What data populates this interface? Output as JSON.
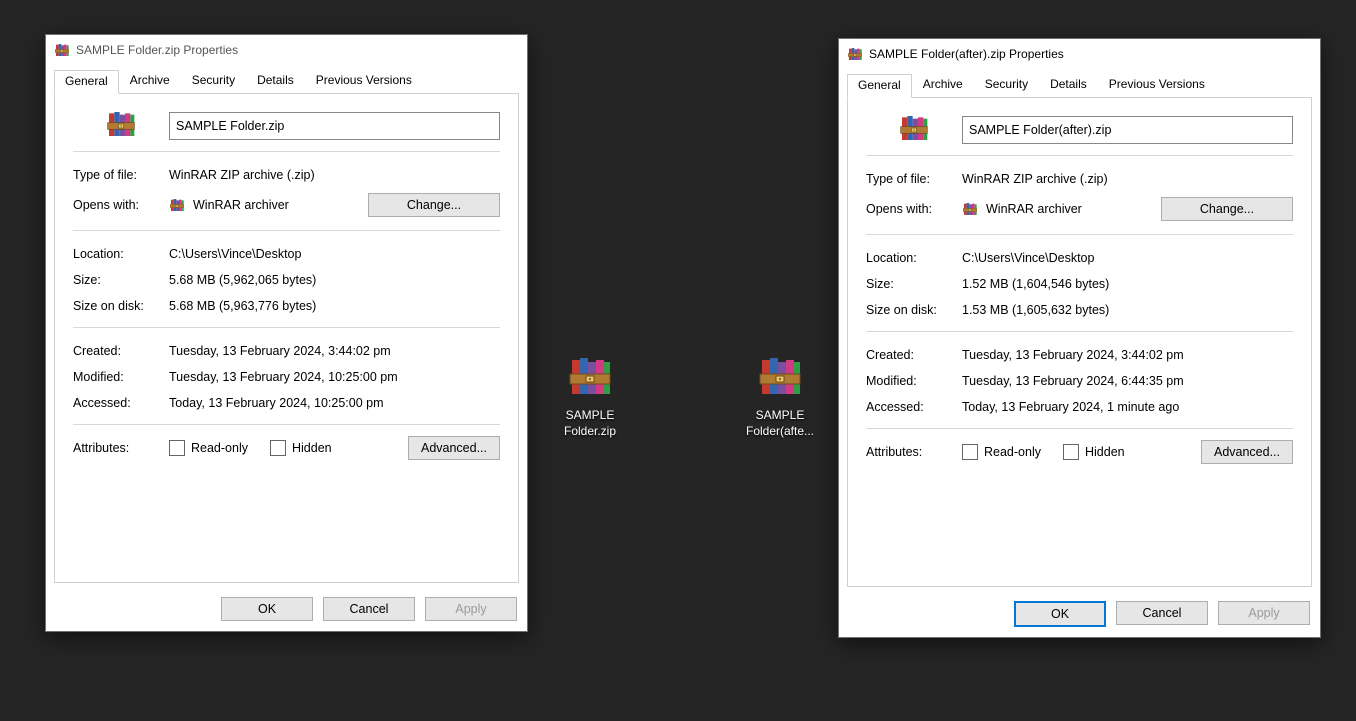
{
  "desktop": {
    "icons": [
      {
        "label": "SAMPLE Folder.zip"
      },
      {
        "label": "SAMPLE Folder(afte..."
      }
    ]
  },
  "tabs": [
    "General",
    "Archive",
    "Security",
    "Details",
    "Previous Versions"
  ],
  "labels": {
    "typeOfFile": "Type of file:",
    "opensWith": "Opens with:",
    "change": "Change...",
    "location": "Location:",
    "size": "Size:",
    "sizeOnDisk": "Size on disk:",
    "created": "Created:",
    "modified": "Modified:",
    "accessed": "Accessed:",
    "attributes": "Attributes:",
    "readOnly": "Read-only",
    "hidden": "Hidden",
    "advanced": "Advanced...",
    "ok": "OK",
    "cancel": "Cancel",
    "apply": "Apply"
  },
  "common": {
    "fileType": "WinRAR ZIP archive (.zip)",
    "opensWithApp": "WinRAR archiver",
    "locationPath": "C:\\Users\\Vince\\Desktop"
  },
  "dlg1": {
    "title": "SAMPLE Folder.zip Properties",
    "filename": "SAMPLE Folder.zip",
    "size": "5.68 MB (5,962,065 bytes)",
    "sizeOnDisk": "5.68 MB (5,963,776 bytes)",
    "created": "Tuesday, 13 February 2024, 3:44:02 pm",
    "modified": "Tuesday, 13 February 2024, 10:25:00 pm",
    "accessed": "Today, 13 February 2024, 10:25:00 pm",
    "focused": false
  },
  "dlg2": {
    "title": "SAMPLE Folder(after).zip Properties",
    "filename": "SAMPLE Folder(after).zip",
    "size": "1.52 MB (1,604,546 bytes)",
    "sizeOnDisk": "1.53 MB (1,605,632 bytes)",
    "created": "Tuesday, 13 February 2024, 3:44:02 pm",
    "modified": "Tuesday, 13 February 2024, 6:44:35 pm",
    "accessed": "Today, 13 February 2024, 1 minute ago",
    "focused": true
  }
}
